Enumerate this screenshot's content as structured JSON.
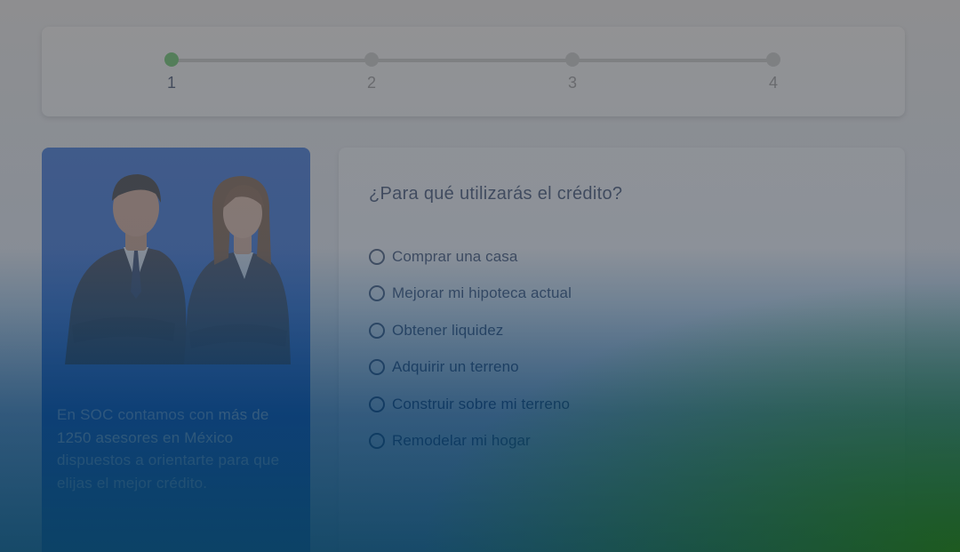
{
  "stepper": {
    "steps": [
      {
        "label": "1",
        "active": true
      },
      {
        "label": "2",
        "active": false
      },
      {
        "label": "3",
        "active": false
      },
      {
        "label": "4",
        "active": false
      }
    ]
  },
  "promo": {
    "text_intro": "En SOC contamos con ",
    "text_highlight": "más de 1250 asesores en México",
    "text_rest": " dispuestos a orientarte para que elijas el mejor crédito."
  },
  "question": {
    "title": "¿Para qué utilizarás el crédito?",
    "options": [
      "Comprar una casa",
      "Mejorar mi hipoteca actual",
      "Obtener liquidez",
      "Adquirir un terreno",
      "Construir sobre mi terreno",
      "Remodelar mi hogar"
    ]
  },
  "colors": {
    "accent_green": "#4cc452",
    "navy_text": "#1d3058",
    "promo_blue": "#1a5fd9"
  }
}
